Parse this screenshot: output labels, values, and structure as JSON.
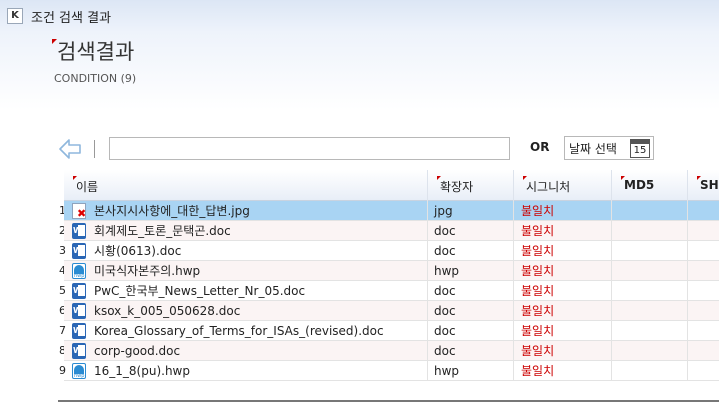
{
  "window": {
    "title": "조건 검색 결과",
    "icon": "app-icon"
  },
  "header": {
    "title": "검색결과",
    "subtitle": "CONDITION (9)"
  },
  "toolbar": {
    "back_icon": "arrow-left-icon",
    "search_value": "",
    "or_label": "OR",
    "date_button_label": "날짜 선택",
    "calendar_day": "15"
  },
  "table": {
    "columns": [
      "이름",
      "확장자",
      "시그니처",
      "MD5",
      "SH"
    ],
    "rows": [
      {
        "num": "1",
        "name": "본사지시사항에_대한_답변.jpg",
        "ext": "jpg",
        "sig": "불일치",
        "icon": "image-error-icon",
        "selected": true
      },
      {
        "num": "2",
        "name": "회계제도_토론_문택곤.doc",
        "ext": "doc",
        "sig": "불일치",
        "icon": "word-doc-icon"
      },
      {
        "num": "3",
        "name": "시황(0613).doc",
        "ext": "doc",
        "sig": "불일치",
        "icon": "word-doc-icon"
      },
      {
        "num": "4",
        "name": "미국식자본주의.hwp",
        "ext": "hwp",
        "sig": "불일치",
        "icon": "hwp-icon"
      },
      {
        "num": "5",
        "name": "PwC_한국부_News_Letter_Nr_05.doc",
        "ext": "doc",
        "sig": "불일치",
        "icon": "word-doc-icon"
      },
      {
        "num": "6",
        "name": "ksox_k_005_050628.doc",
        "ext": "doc",
        "sig": "불일치",
        "icon": "word-doc-icon"
      },
      {
        "num": "7",
        "name": "Korea_Glossary_of_Terms_for_ISAs_(revised).doc",
        "ext": "doc",
        "sig": "불일치",
        "icon": "word-doc-icon"
      },
      {
        "num": "8",
        "name": "corp-good.doc",
        "ext": "doc",
        "sig": "불일치",
        "icon": "word-doc-icon"
      },
      {
        "num": "9",
        "name": "16_1_8(pu).hwp",
        "ext": "hwp",
        "sig": "불일치",
        "icon": "hwp-icon"
      }
    ]
  },
  "colors": {
    "selected_row": "#a9d4f3",
    "mismatch_text": "#cc0000",
    "header_mark": "#cc0000"
  }
}
